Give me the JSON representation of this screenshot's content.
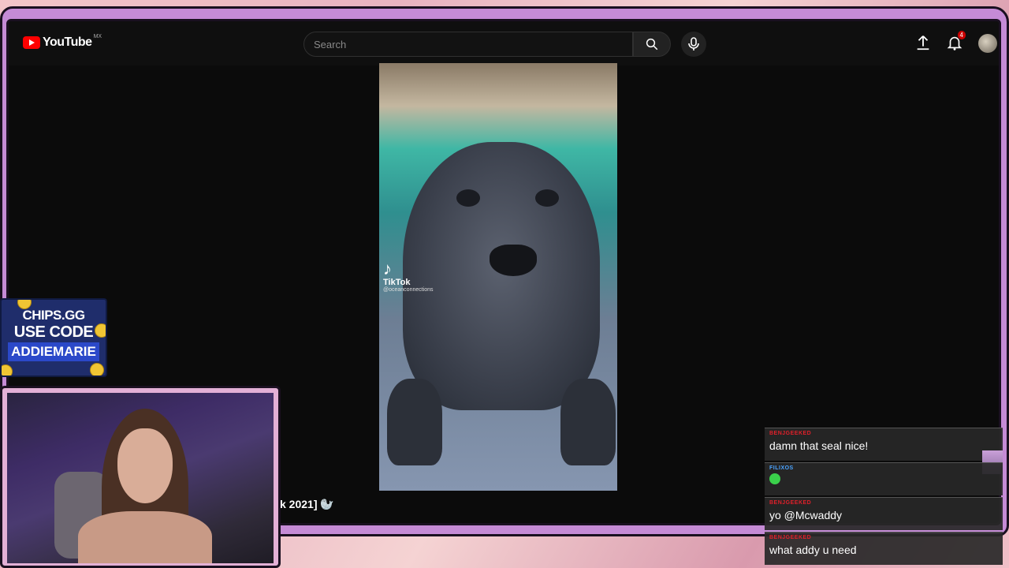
{
  "youtube": {
    "logo_text": "YouTube",
    "region": "MX",
    "search_placeholder": "Search",
    "notification_count": "4"
  },
  "video": {
    "watermark_brand": "TikTok",
    "watermark_handle": "@oceanconnections",
    "title_fragment": "k 2021] 🦭"
  },
  "sponsor": {
    "line1": "CHIPS.GG",
    "line2": "USE CODE",
    "line3": "ADDIEMARIE"
  },
  "chat": {
    "messages": [
      {
        "user": "BENJGEEKED",
        "user_color": "#e0202a",
        "text": "damn that seal nice!"
      },
      {
        "user": "FILIXOS",
        "user_color": "#4aa3ff",
        "text": "",
        "emote": "frog-emote"
      },
      {
        "user": "BENJGEEKED",
        "user_color": "#e0202a",
        "text": "yo @Mcwaddy"
      },
      {
        "user": "BENJGEEKED",
        "user_color": "#e0202a",
        "text": "what addy u need"
      }
    ]
  },
  "colors": {
    "frame": "#c58bd6",
    "youtube_red": "#ff0000",
    "sponsor_bg": "#1f2d6b"
  }
}
